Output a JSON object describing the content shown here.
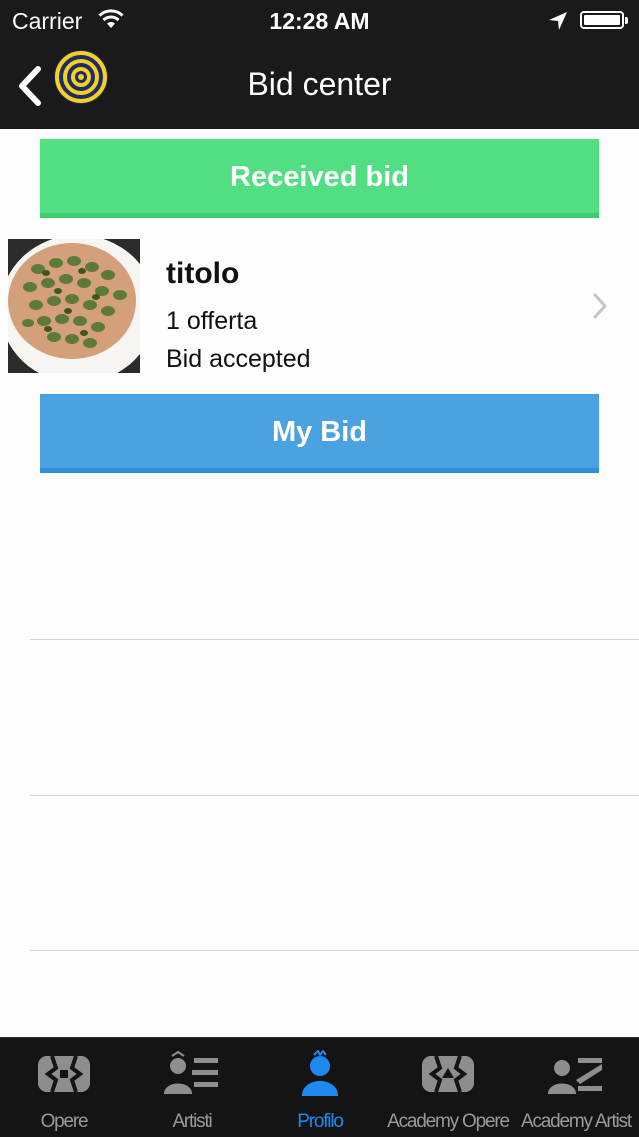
{
  "status_bar": {
    "carrier": "Carrier",
    "time": "12:28 AM"
  },
  "nav": {
    "title": "Bid center"
  },
  "received_section": {
    "label": "Received bid"
  },
  "received_bids": [
    {
      "title": "titolo",
      "offers": "1 offerta",
      "status": "Bid accepted"
    }
  ],
  "my_bid_section": {
    "label": "My Bid"
  },
  "tabs": [
    {
      "label": "Opere",
      "icon": "opere-icon",
      "active": false
    },
    {
      "label": "Artisti",
      "icon": "artisti-icon",
      "active": false
    },
    {
      "label": "Profilo",
      "icon": "profilo-icon",
      "active": true
    },
    {
      "label": "Academy Opere",
      "icon": "academy-opere-icon",
      "active": false
    },
    {
      "label": "Academy Artist",
      "icon": "academy-artist-icon",
      "active": false
    }
  ],
  "colors": {
    "received_green": "#52de82",
    "my_bid_blue": "#4aa2e1",
    "active_tab": "#1e8af1",
    "bar_background": "#1a1a1a"
  }
}
